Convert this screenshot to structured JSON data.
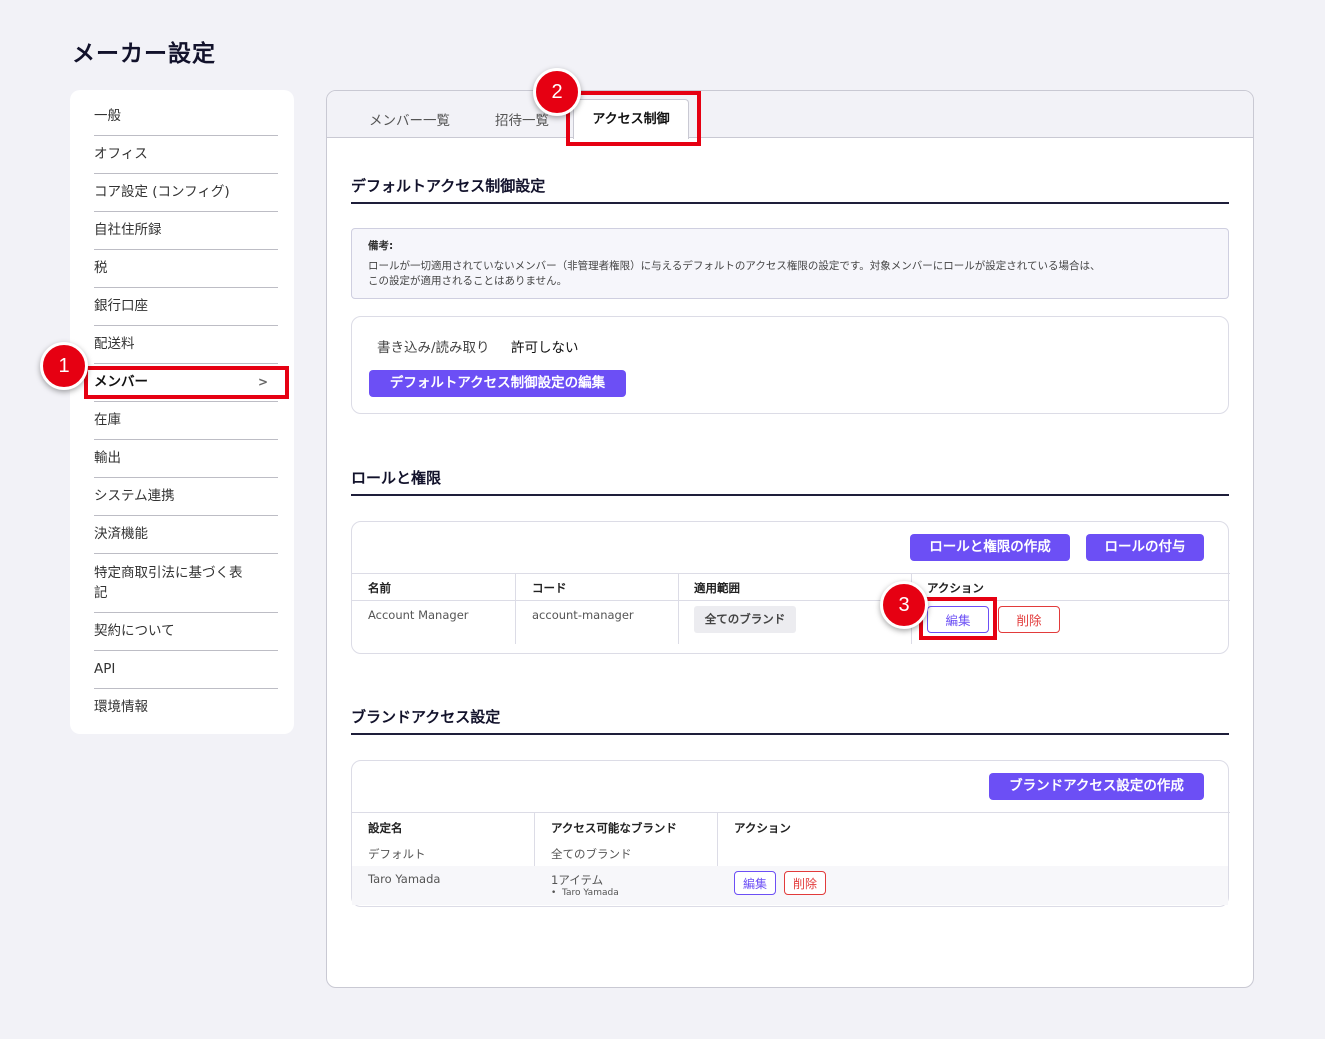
{
  "page": {
    "title": "メーカー設定"
  },
  "sidebar": {
    "items": [
      {
        "label": "一般"
      },
      {
        "label": "オフィス"
      },
      {
        "label": "コア設定 (コンフィグ)"
      },
      {
        "label": "自社住所録"
      },
      {
        "label": "税"
      },
      {
        "label": "銀行口座"
      },
      {
        "label": "配送料"
      },
      {
        "label": "メンバー",
        "chevron": ">"
      },
      {
        "label": "在庫"
      },
      {
        "label": "輸出"
      },
      {
        "label": "システム連携"
      },
      {
        "label": "決済機能"
      },
      {
        "label": "特定商取引法に基づく表",
        "label2": "記"
      },
      {
        "label": "契約について"
      },
      {
        "label": "API"
      },
      {
        "label": "環境情報"
      }
    ]
  },
  "tabs": [
    {
      "label": "メンバー一覧"
    },
    {
      "label": "招待一覧"
    },
    {
      "label": "アクセス制御"
    }
  ],
  "default_access": {
    "title": "デフォルトアクセス制御設定",
    "note_title": "備考:",
    "note_line1": "ロールが一切適用されていないメンバー（非管理者権限）に与えるデフォルトのアクセス権限の設定です。対象メンバーにロールが設定されている場合は、",
    "note_line2": "この設定が適用されることはありません。",
    "perm_label": "書き込み/読み取り",
    "perm_value": "許可しない",
    "edit_button": "デフォルトアクセス制御設定の編集"
  },
  "roles": {
    "title": "ロールと権限",
    "create_button": "ロールと権限の作成",
    "assign_button": "ロールの付与",
    "headers": [
      "名前",
      "コード",
      "適用範囲",
      "アクション"
    ],
    "rows": [
      {
        "name": "Account Manager",
        "code": "account-manager",
        "scope": "全てのブランド",
        "edit": "編集",
        "delete": "削除"
      }
    ]
  },
  "brand_access": {
    "title": "ブランドアクセス設定",
    "create_button": "ブランドアクセス設定の作成",
    "headers": [
      "設定名",
      "アクセス可能なブランド",
      "アクション"
    ],
    "rows": [
      {
        "name": "デフォルト",
        "brands": "全てのブランド"
      },
      {
        "name": "Taro Yamada",
        "brands": "1アイテム",
        "brand_item": "Taro Yamada",
        "edit": "編集",
        "delete": "削除"
      }
    ]
  },
  "annotations": {
    "badge1": "1",
    "badge2": "2",
    "badge3": "3"
  },
  "colors": {
    "accent": "#6c4ff5",
    "highlight": "#e60012",
    "danger": "#e23b3b"
  }
}
